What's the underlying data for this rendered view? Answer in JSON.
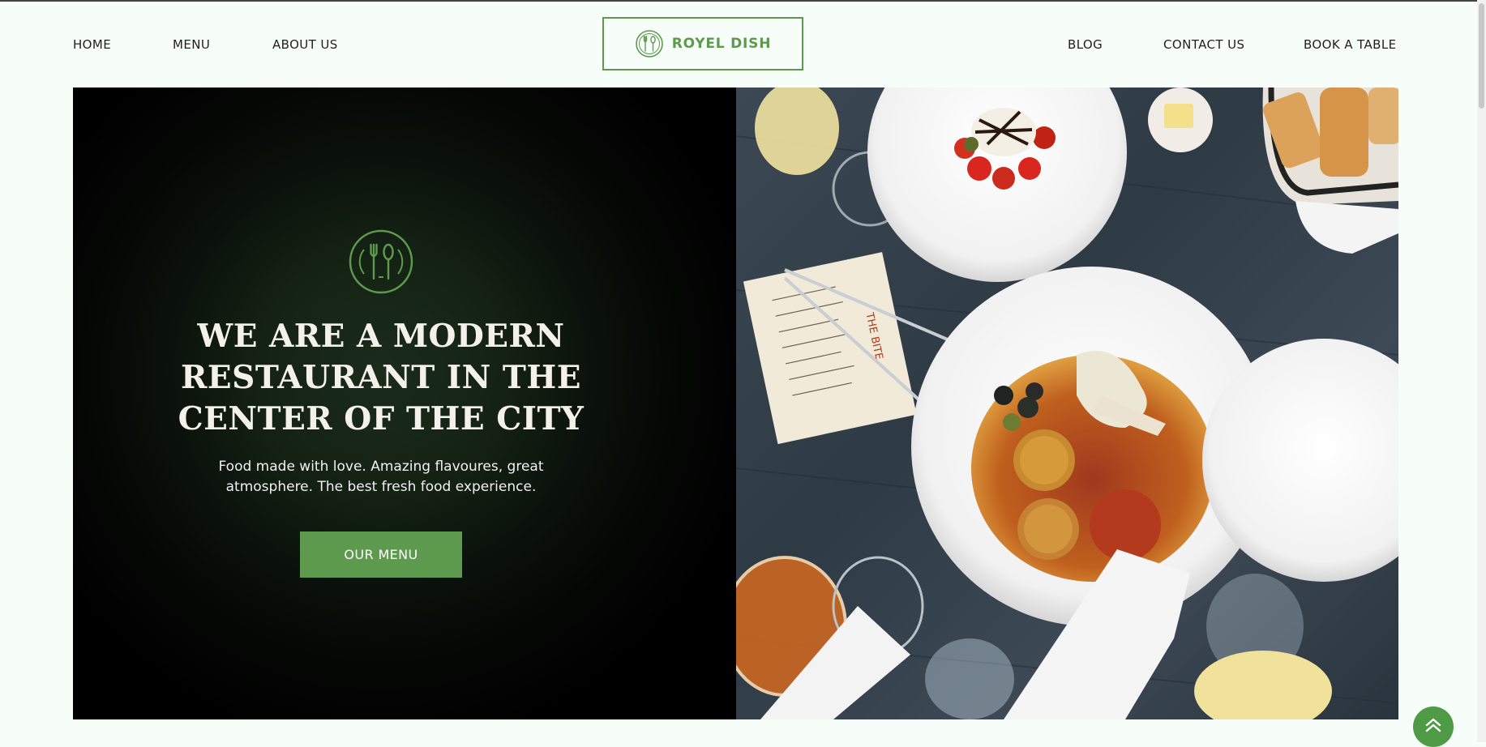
{
  "header": {
    "nav_left": [
      "HOME",
      "MENU",
      "ABOUT US"
    ],
    "nav_right": [
      "BLOG",
      "CONTACT US",
      "BOOK A TABLE"
    ],
    "logo_text": "ROYEL DISH",
    "logo_icon": "fork-spoon-icon"
  },
  "hero": {
    "emblem_icon": "fork-spoon-circle-icon",
    "title_lines": [
      "WE ARE A MODERN",
      "RESTAURANT IN THE",
      "CENTER OF THE CITY"
    ],
    "subtitle_lines": [
      "Food made with love. Amazing flavoures, great",
      "atmosphere. The best fresh food experience."
    ],
    "button_label": "OUR MENU",
    "image_subject": "top-down view of restaurant table with plated dishes"
  },
  "colors": {
    "accent": "#5e9a4e",
    "background": "#f7fdf9",
    "hero_dark": "#000000",
    "text_dark": "#1f1f1f"
  },
  "widgets": {
    "back_to_top_icon": "double-chevron-up-icon"
  }
}
